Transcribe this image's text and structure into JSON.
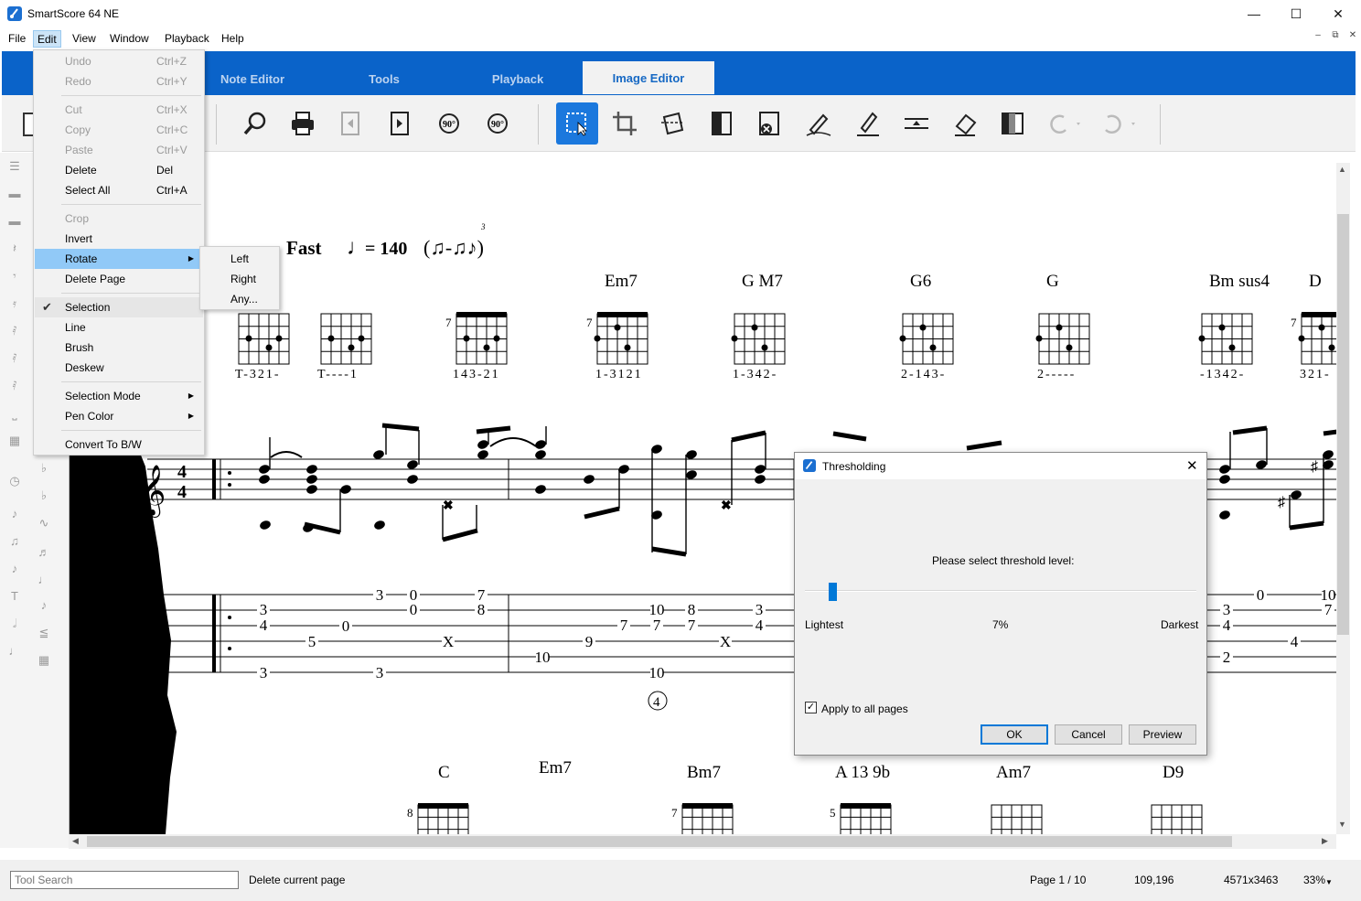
{
  "window": {
    "title": "SmartScore 64 NE",
    "min_icon": "minimize-icon",
    "max_icon": "maximize-icon",
    "close_icon": "close-icon"
  },
  "menubar": {
    "items": [
      "File",
      "Edit",
      "View",
      "Window",
      "Playback",
      "Help"
    ]
  },
  "ribbon": {
    "tabs": [
      "Note Editor",
      "Tools",
      "Playback",
      "Image Editor"
    ],
    "active": "Image Editor",
    "color": "#0a63c9"
  },
  "edit_menu": {
    "undo": {
      "label": "Undo",
      "shortcut": "Ctrl+Z"
    },
    "redo": {
      "label": "Redo",
      "shortcut": "Ctrl+Y"
    },
    "cut": {
      "label": "Cut",
      "shortcut": "Ctrl+X"
    },
    "copy": {
      "label": "Copy",
      "shortcut": "Ctrl+C"
    },
    "paste": {
      "label": "Paste",
      "shortcut": "Ctrl+V"
    },
    "delete": {
      "label": "Delete",
      "shortcut": "Del"
    },
    "select_all": {
      "label": "Select All",
      "shortcut": "Ctrl+A"
    },
    "crop": "Crop",
    "invert": "Invert",
    "rotate": "Rotate",
    "delete_page": "Delete Page",
    "selection": "Selection",
    "line": "Line",
    "brush": "Brush",
    "deskew": "Deskew",
    "selection_mode": "Selection Mode",
    "pen_color": "Pen Color",
    "convert": "Convert To B/W"
  },
  "rotate_submenu": [
    "Left",
    "Right",
    "Any..."
  ],
  "score": {
    "tempo_text": "Fast",
    "tempo_value": "= 140",
    "triplet": "3",
    "chords_row1": [
      {
        "name": "Em7",
        "fret": "7",
        "fingers": "1-3121"
      },
      {
        "name": "G M7",
        "fret": "",
        "fingers": "1-342-"
      },
      {
        "name": "G6",
        "fret": "",
        "fingers": "2-143-"
      },
      {
        "name": "G",
        "fret": "",
        "fingers": "2-----"
      },
      {
        "name": "Bm sus4",
        "fret": "",
        "fingers": "-1342-"
      },
      {
        "name": "D",
        "fret": "7",
        "fingers": "321-"
      }
    ],
    "chords_row1_unnamed": [
      {
        "fret": "",
        "fingers": "T-321-"
      },
      {
        "fret": "",
        "fingers": "T----1"
      },
      {
        "fret": "7",
        "fingers": "143-21"
      }
    ],
    "chords_row2": [
      {
        "name": "C",
        "fret": "8"
      },
      {
        "name": "Em7",
        "fret": ""
      },
      {
        "name": "Bm7",
        "fret": "7"
      },
      {
        "name": "A 13 9b",
        "fret": "5"
      },
      {
        "name": "Am7",
        "fret": ""
      },
      {
        "name": "D9",
        "fret": ""
      }
    ],
    "time_signature": [
      "4",
      "4"
    ],
    "measure_number": "4",
    "tab_numbers": [
      "3",
      "4",
      "3",
      "5",
      "0",
      "3",
      "3",
      "0",
      "0",
      "X",
      "7",
      "8",
      "10",
      "9",
      "10",
      "7",
      "7",
      "10",
      "8",
      "7",
      "7",
      "X",
      "3",
      "4",
      "0",
      "10",
      "3",
      "4",
      "2",
      "4",
      "7",
      "10"
    ]
  },
  "dialog": {
    "title": "Thresholding",
    "prompt": "Please select threshold level:",
    "min_label": "Lightest",
    "value": "7%",
    "max_label": "Darkest",
    "apply_all": "Apply to all pages",
    "ok": "OK",
    "cancel": "Cancel",
    "preview": "Preview",
    "slider_fraction": 0.07
  },
  "status": {
    "search_placeholder": "Tool Search",
    "message": "Delete current page",
    "page": "Page 1 / 10",
    "coords": "109,196",
    "dims": "4571x3463",
    "zoom": "33%"
  }
}
